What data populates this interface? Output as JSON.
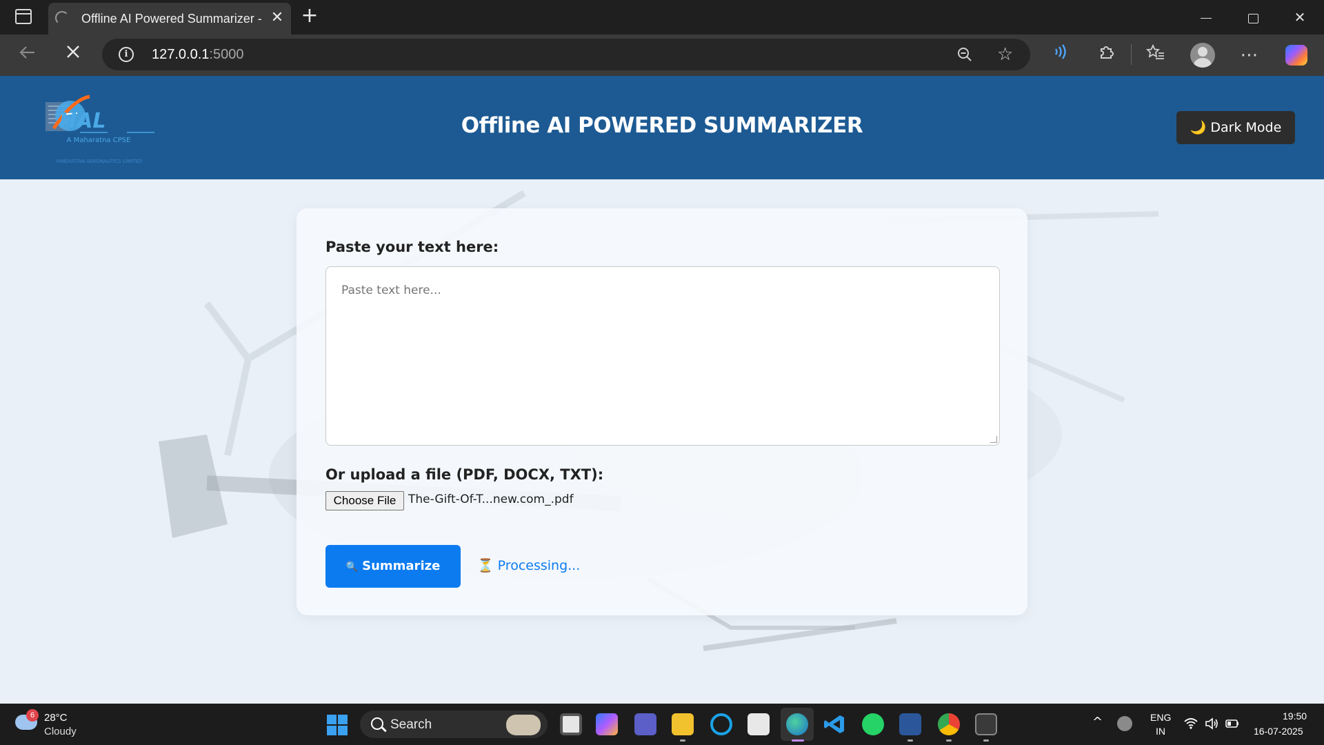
{
  "browser": {
    "tab_title": "Offline AI Powered Summarizer - ",
    "close_glyph": "✕",
    "new_tab_glyph": "+",
    "url_host": "127.0.0.1",
    "url_port": ":5000"
  },
  "app": {
    "logo": {
      "brand_devanagari": "एचएएल",
      "brand": "HAL",
      "tagline": "A Maharatna CPSE",
      "subtitle_devanagari": "हिन्दुस्तान एरोनॉटिक्स लिमिटेड",
      "subtitle": "HINDUSTAN AERONAUTICS LIMITED"
    },
    "title": "Offline AI POWERED SUMMARIZER",
    "dark_mode_label": "Dark Mode",
    "dark_mode_icon": "🌙"
  },
  "form": {
    "text_label": "Paste your text here:",
    "text_placeholder": "Paste text here...",
    "file_label": "Or upload a file (PDF, DOCX, TXT):",
    "choose_file_label": "Choose File",
    "file_name": "The-Gift-Of-T...new.com_.pdf",
    "summarize_label": "Summarize",
    "summarize_icon": "🔍",
    "status_icon": "⏳",
    "status_text": "Processing..."
  },
  "taskbar": {
    "weather_badge": "6",
    "temperature": "28°C",
    "condition": "Cloudy",
    "search_label": "Search",
    "lang_line1": "ENG",
    "lang_line2": "IN",
    "time": "19:50",
    "date": "16-07-2025"
  },
  "colors": {
    "header_bg": "#1d5a93",
    "accent": "#0d7bf0",
    "page_bg": "#e9f0f8"
  }
}
